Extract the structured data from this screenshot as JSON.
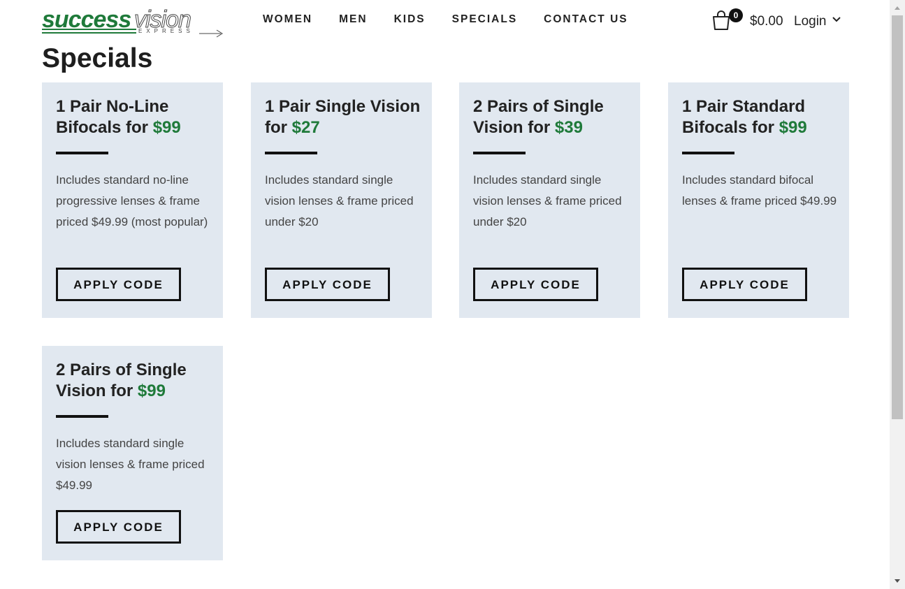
{
  "logo": {
    "success": "success",
    "vision": "vision",
    "express": "EXPRESS"
  },
  "nav": [
    "WOMEN",
    "MEN",
    "KIDS",
    "SPECIALS",
    "CONTACT US"
  ],
  "cart": {
    "count": "0",
    "total": "$0.00"
  },
  "login": "Login",
  "page": {
    "title": "Specials"
  },
  "cards": [
    {
      "title": "1 Pair No-Line Bifocals for",
      "price": "$99",
      "description": "Includes standard no-line progressive lenses & frame priced $49.99 (most popular)",
      "button": "APPLY CODE"
    },
    {
      "title": "1 Pair Single Vision for",
      "price": "$27",
      "description": "Includes standard single vision lenses & frame priced under $20",
      "button": "APPLY CODE"
    },
    {
      "title": "2 Pairs of Single Vision for",
      "price": "$39",
      "description": "Includes standard single vision lenses & frame priced under $20",
      "button": "APPLY CODE"
    },
    {
      "title": "1 Pair Standard Bifocals for",
      "price": "$99",
      "description": "Includes standard bifocal lenses & frame priced $49.99",
      "button": "APPLY CODE"
    },
    {
      "title": "2 Pairs of Single Vision for",
      "price": "$99",
      "description": "Includes standard single vision lenses & frame priced $49.99",
      "button": "APPLY CODE"
    }
  ],
  "colors": {
    "accent_green": "#1f7a3a",
    "card_bg": "#e1e8f0",
    "text": "#222222"
  }
}
